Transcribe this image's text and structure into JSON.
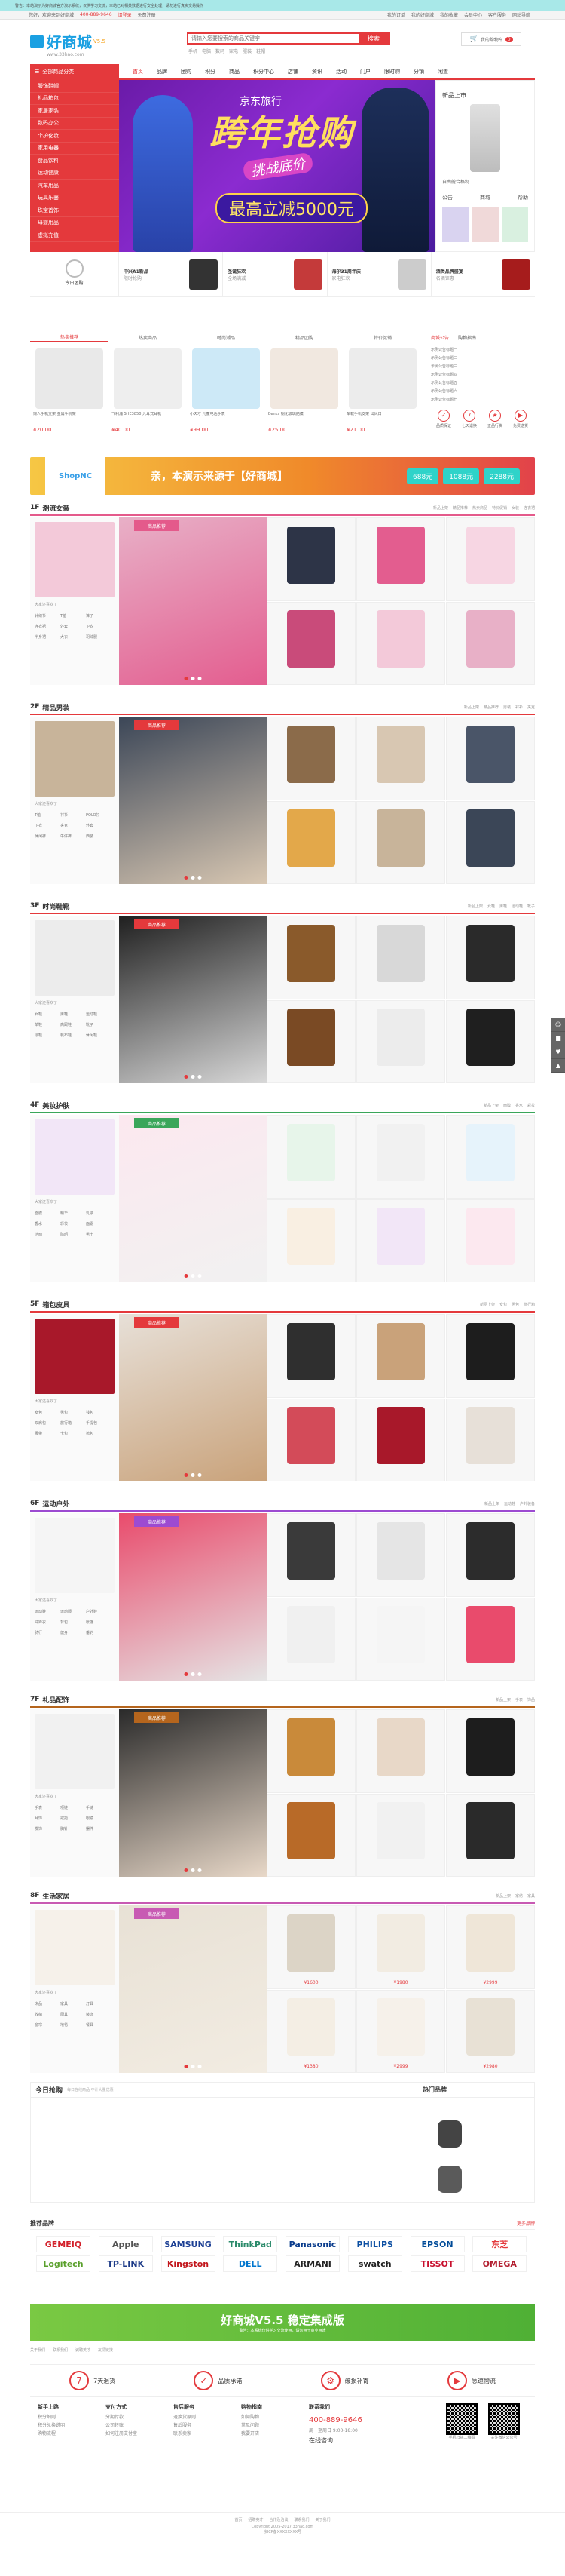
{
  "topbar": {
    "text": "警告：本站演示为好商城官方演示系统，仅供学习交流，本站已对相关数据进行安全处理，请勿进行真实交易操作"
  },
  "util": {
    "welcome": "您好，欢迎来到好商城",
    "phone": "400-889-9646",
    "login": "请登录",
    "register": "免费注册",
    "links": [
      "我的订单",
      "我的好商城",
      "我的收藏",
      "会员中心",
      "客户服务",
      "网站导航"
    ]
  },
  "logo": {
    "title": "好商城",
    "version": "V5.5",
    "sub": "www.33hao.com"
  },
  "search": {
    "placeholder": "请输入您要搜索的商品关键字",
    "button": "搜索",
    "hot": [
      "手机",
      "电脑",
      "数码",
      "家电",
      "服装",
      "鞋帽"
    ]
  },
  "cart": {
    "label": "我的购物车",
    "count": "0"
  },
  "nav": {
    "all": "全部商品分类",
    "items": [
      "首页",
      "品牌",
      "团购",
      "积分",
      "商品",
      "积分中心",
      "店铺",
      "资讯",
      "活动",
      "门户",
      "限时购",
      "分销",
      "闲置"
    ]
  },
  "categories": [
    "服饰鞋帽",
    "礼品箱包",
    "家居家装",
    "数码办公",
    "个护化妆",
    "家用电器",
    "食品饮料",
    "运动健康",
    "汽车用品",
    "玩具乐器",
    "珠宝首饰",
    "母婴用品",
    "虚拟充值"
  ],
  "banner": {
    "brand": "京东旅行",
    "headline": "跨年抢购",
    "sub": "挑战底价",
    "price": "最高立减5000元"
  },
  "right_side": {
    "title": "新品上市",
    "sub": "自由舱合格制",
    "links": [
      "公告",
      "商城",
      "帮助"
    ]
  },
  "promos": [
    {
      "title": "中兴A1新品",
      "desc": "限时抢购"
    },
    {
      "title": "圣诞狂欢",
      "desc": "全场满减"
    },
    {
      "title": "海尔31周年庆",
      "desc": "家电狂欢"
    },
    {
      "title": "酒类品牌盛宴",
      "desc": "名酒钜惠"
    }
  ],
  "today_logo": "今日团购",
  "hot": {
    "tabs": [
      "热卖推荐",
      "热卖商品",
      "时尚潮品",
      "精品团购",
      "特价促销"
    ],
    "items": [
      {
        "name": "懒人手机支架 金属手机架",
        "price": "¥20.00"
      },
      {
        "name": "飞利浦 SHE3850 入耳式耳机",
        "price": "¥40.00"
      },
      {
        "name": "小天才 儿童电话手表",
        "price": "¥99.00"
      },
      {
        "name": "Benks 钢化玻璃贴膜",
        "price": "¥25.00"
      },
      {
        "name": "车载手机支架 出风口",
        "price": "¥21.00"
      }
    ]
  },
  "news": {
    "tabs": [
      "商城公告",
      "购物指南"
    ],
    "items": [
      "示例公告标题一",
      "示例公告标题二",
      "示例公告标题三",
      "示例公告标题四",
      "示例公告标题五",
      "示例公告标题六",
      "示例公告标题七"
    ],
    "services": [
      "品质保证",
      "七天退换",
      "正品行货",
      "免费送货"
    ]
  },
  "ad": {
    "brand": "ShopNC",
    "text": "亲，本演示来源于【好商城】",
    "coupons": [
      "688元",
      "1088元",
      "2288元"
    ]
  },
  "floors": [
    {
      "num": "1F",
      "name": "潮流女装",
      "color": "#e45a8b",
      "tag": "商品推荐",
      "tabs": [
        "新品上架",
        "精品推荐",
        "热卖商品",
        "特价促销",
        "女装",
        "连衣裙"
      ],
      "more": "大家还喜欢了",
      "cats": [
        "针织衫",
        "T恤",
        "裤子",
        "连衣裙",
        "外套",
        "卫衣",
        "半身裙",
        "大衣",
        "羽绒服"
      ]
    },
    {
      "num": "2F",
      "name": "精品男装",
      "color": "#e4393c",
      "tag": "商品推荐",
      "tabs": [
        "新品上架",
        "精品推荐",
        "男装",
        "衬衫",
        "夹克"
      ],
      "more": "大家还喜欢了",
      "cats": [
        "T恤",
        "衬衫",
        "POLO衫",
        "卫衣",
        "夹克",
        "外套",
        "休闲裤",
        "牛仔裤",
        "西装"
      ]
    },
    {
      "num": "3F",
      "name": "时尚鞋靴",
      "color": "#e4393c",
      "tag": "商品推荐",
      "tabs": [
        "新品上架",
        "女鞋",
        "男鞋",
        "运动鞋",
        "靴子"
      ],
      "more": "大家还喜欢了",
      "cats": [
        "女鞋",
        "男鞋",
        "运动鞋",
        "单鞋",
        "高跟鞋",
        "靴子",
        "凉鞋",
        "帆布鞋",
        "休闲鞋"
      ]
    },
    {
      "num": "4F",
      "name": "美妆护肤",
      "color": "#3aa65a",
      "tag": "商品推荐",
      "tabs": [
        "新品上架",
        "面膜",
        "香水",
        "彩妆"
      ],
      "more": "大家还喜欢了",
      "cats": [
        "面膜",
        "精华",
        "乳液",
        "香水",
        "彩妆",
        "面霜",
        "洁面",
        "防晒",
        "男士"
      ]
    },
    {
      "num": "5F",
      "name": "箱包皮具",
      "color": "#e4393c",
      "tag": "商品推荐",
      "tabs": [
        "新品上架",
        "女包",
        "男包",
        "旅行箱"
      ],
      "more": "大家还喜欢了",
      "cats": [
        "女包",
        "男包",
        "钱包",
        "双肩包",
        "旅行箱",
        "手提包",
        "腰带",
        "卡包",
        "挎包"
      ]
    },
    {
      "num": "6F",
      "name": "运动户外",
      "color": "#9c4bd1",
      "tag": "商品推荐",
      "tabs": [
        "新品上架",
        "运动鞋",
        "户外装备"
      ],
      "more": "大家还喜欢了",
      "cats": [
        "运动鞋",
        "运动服",
        "户外鞋",
        "冲锋衣",
        "背包",
        "帐篷",
        "骑行",
        "健身",
        "垂钓"
      ]
    },
    {
      "num": "7F",
      "name": "礼品配饰",
      "color": "#b5651d",
      "tag": "商品推荐",
      "tabs": [
        "新品上架",
        "手表",
        "饰品"
      ],
      "more": "大家还喜欢了",
      "cats": [
        "手表",
        "项链",
        "手链",
        "耳饰",
        "戒指",
        "眼镜",
        "发饰",
        "胸针",
        "摆件"
      ]
    },
    {
      "num": "8F",
      "name": "生活家居",
      "color": "#c85ab3",
      "tag": "商品推荐",
      "tabs": [
        "新品上架",
        "家纺",
        "家具"
      ],
      "more": "大家还喜欢了",
      "cats": [
        "床品",
        "家具",
        "灯具",
        "收纳",
        "厨具",
        "装饰",
        "窗帘",
        "地毯",
        "餐具"
      ]
    }
  ],
  "floor8_extra": {
    "left_title": "老板电器",
    "prices": [
      "¥1600",
      "¥1980",
      "¥2999",
      "¥1380",
      "¥2999",
      "¥2980"
    ]
  },
  "guess": {
    "title": "今日抢购",
    "sub": "每日在线商品 不计大量优惠",
    "hot_title": "热门品牌"
  },
  "brands": {
    "title": "推荐品牌",
    "more": "更多品牌",
    "items": [
      "GEMEIQ",
      "Apple",
      "SAMSUNG",
      "ThinkPad",
      "Panasonic",
      "PHILIPS",
      "EPSON",
      "东芝",
      "Logitech",
      "TP-LINK",
      "Kingston",
      "DELL",
      "ARMANI",
      "swatch",
      "TISSOT",
      "OMEGA"
    ]
  },
  "bottom_ad": {
    "text": "好商城V5.5 稳定集成版",
    "sub": "警告：本系统仅供学习交流使用，请勿用于商业用途"
  },
  "links_row": [
    "关于我们",
    "联系我们",
    "诚聘英才",
    "友情链接"
  ],
  "guarantees": [
    "7天退货",
    "品质承诺",
    "破损补寄",
    "急速物流"
  ],
  "footer_cols": [
    {
      "title": "新手上路",
      "items": [
        "积分细则",
        "积分兑换说明",
        "购物流程"
      ]
    },
    {
      "title": "支付方式",
      "items": [
        "分期付款",
        "公司转账",
        "如何注册支付宝"
      ]
    },
    {
      "title": "售后服务",
      "items": [
        "退换货原则",
        "售后服务",
        "联系卖家"
      ]
    },
    {
      "title": "购物指南",
      "items": [
        "如何购物",
        "常见问题",
        "我要开店"
      ]
    }
  ],
  "contact": {
    "title": "联系我们",
    "phone": "400-889-9646",
    "hours": "周一至周日 9:00-18:00",
    "online": "在线咨询",
    "qr1": "手机扫描二维码",
    "qr2": "关注微信公众号"
  },
  "copyright": {
    "links": [
      "首页",
      "招聘英才",
      "合作及洽谈",
      "联系我们",
      "关于我们"
    ],
    "text": "Copyright 2005-2017 33hao.com",
    "icp": "京ICP备XXXXXXXX号"
  },
  "colors": {
    "accent": "#e4393c",
    "topbar": "#a8e8e8"
  }
}
